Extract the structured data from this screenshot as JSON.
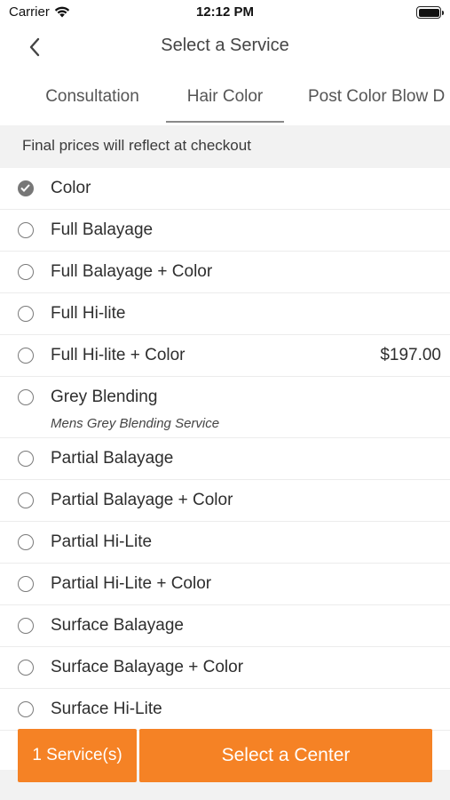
{
  "status_bar": {
    "carrier": "Carrier",
    "time": "12:12 PM",
    "icons": [
      "wifi-icon",
      "battery-icon"
    ]
  },
  "nav": {
    "title": "Select a Service",
    "back_icon": "chevron-left-icon"
  },
  "tabs": [
    {
      "label": "Consultation",
      "active": false
    },
    {
      "label": "Hair Color",
      "active": true
    },
    {
      "label": "Post Color Blow D",
      "active": false
    }
  ],
  "price_note": "Final prices will reflect at checkout",
  "services": [
    {
      "name": "Color",
      "selected": true,
      "price": "",
      "subtitle": ""
    },
    {
      "name": "Full Balayage",
      "selected": false,
      "price": "",
      "subtitle": ""
    },
    {
      "name": "Full Balayage + Color",
      "selected": false,
      "price": "",
      "subtitle": ""
    },
    {
      "name": "Full Hi-lite",
      "selected": false,
      "price": "",
      "subtitle": ""
    },
    {
      "name": "Full Hi-lite + Color",
      "selected": false,
      "price": "$197.00",
      "subtitle": ""
    },
    {
      "name": "Grey Blending",
      "selected": false,
      "price": "",
      "subtitle": "Mens Grey Blending Service"
    },
    {
      "name": "Partial Balayage",
      "selected": false,
      "price": "",
      "subtitle": ""
    },
    {
      "name": "Partial Balayage + Color",
      "selected": false,
      "price": "",
      "subtitle": ""
    },
    {
      "name": "Partial Hi-Lite",
      "selected": false,
      "price": "",
      "subtitle": ""
    },
    {
      "name": "Partial Hi-Lite + Color",
      "selected": false,
      "price": "",
      "subtitle": ""
    },
    {
      "name": "Surface Balayage",
      "selected": false,
      "price": "",
      "subtitle": ""
    },
    {
      "name": "Surface Balayage + Color",
      "selected": false,
      "price": "",
      "subtitle": ""
    },
    {
      "name": "Surface Hi-Lite",
      "selected": false,
      "price": "",
      "subtitle": ""
    }
  ],
  "footer": {
    "count_label": "1 Service(s)",
    "select_center_label": "Select a Center"
  },
  "colors": {
    "accent": "#f58225",
    "banner_bg": "#f2f2f2",
    "radio_checked": "#777777"
  }
}
